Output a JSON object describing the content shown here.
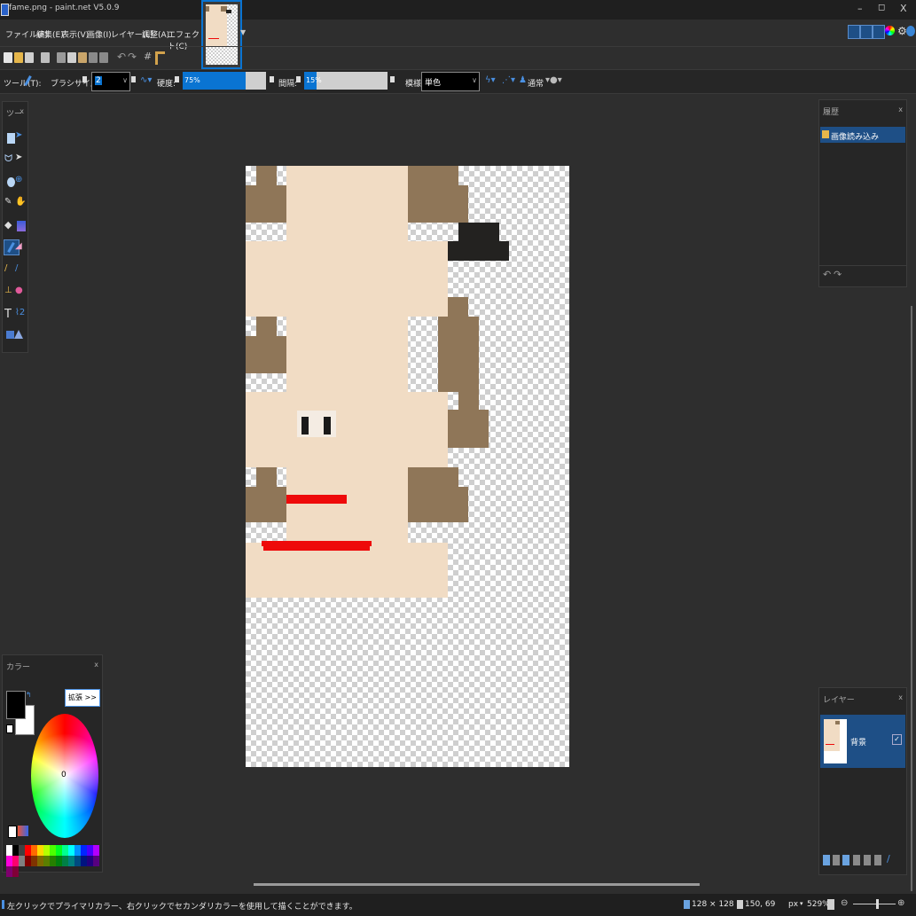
{
  "window": {
    "title": "fame.png - paint.net V5.0.9",
    "controls": {
      "minimize": "–",
      "maximize": "◻",
      "close": "X"
    }
  },
  "menu": [
    "ファイル(F)",
    "編集(E)",
    "表示(V)",
    "画像(I)",
    "レイヤー(L)",
    "調整(A)",
    "エフェクト(C)"
  ],
  "toolbar2": {
    "tool_label": "ツール(T):",
    "brush_size_label": "ブラシサイズ:",
    "brush_size_value": "2",
    "hardness_label": "硬度:",
    "hardness_value": "75%",
    "hardness_fraction": 0.75,
    "spacing_label": "間隔:",
    "spacing_value": "15%",
    "spacing_fraction": 0.15,
    "blend_label": "模様:",
    "blend_value": "単色",
    "mode_value": "通常"
  },
  "tools_panel": {
    "title": "ツー"
  },
  "history_panel": {
    "title": "履歴",
    "items": [
      "画像読み込み"
    ]
  },
  "colors_panel": {
    "title": "カラー",
    "expand_button": "拡張 >>",
    "wheel_center": "0",
    "primary_color": "#000000",
    "secondary_color": "#ffffff",
    "palette": [
      "#ffffff",
      "#000000",
      "#404040",
      "#ff0000",
      "#ff6a00",
      "#ffd800",
      "#b6ff00",
      "#4cff00",
      "#00ff21",
      "#00ff90",
      "#00ffff",
      "#0094ff",
      "#0026ff",
      "#4800ff",
      "#b200ff",
      "#ff00dc",
      "#ff006e",
      "#808080",
      "#7f0000",
      "#7f3300",
      "#7f6a00",
      "#5b7f00",
      "#267f00",
      "#007f0e",
      "#007f46",
      "#007f7f",
      "#004a7f",
      "#00137f",
      "#21007f",
      "#57007f",
      "#7f006e",
      "#7f0037"
    ]
  },
  "layers_panel": {
    "title": "レイヤー",
    "layers": [
      {
        "name": "背景",
        "visible": true
      }
    ]
  },
  "status": {
    "hint": "左クリックでプライマリカラー、右クリックでセカンダリカラーを使用して描くことができます。",
    "image_size": "128 × 128",
    "cursor_pos": "150, 69",
    "units": "px",
    "zoom": "529%"
  },
  "colors": {
    "skin": "#f1dcc4",
    "brown": "#8f7658",
    "dark": "#232220",
    "red": "#ee0a0a",
    "accent": "#0a74d2"
  }
}
